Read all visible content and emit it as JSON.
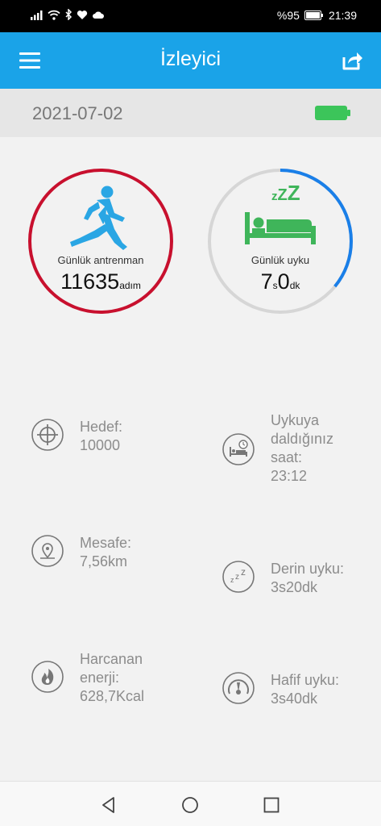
{
  "status_bar": {
    "battery_percent": "%95",
    "time": "21:39"
  },
  "app_bar": {
    "title": "İzleyici",
    "menu_icon": "hamburger-menu-icon",
    "share_icon": "share-icon"
  },
  "date_bar": {
    "date": "2021-07-02",
    "battery_icon": "device-battery-full-icon"
  },
  "activity": {
    "label": "Günlük antrenman",
    "steps": "11635",
    "unit": "adım",
    "ring_color": "#c8102e",
    "progress": 1.0
  },
  "sleep": {
    "label": "Günlük uyku",
    "hours": "7",
    "hours_unit": "s",
    "minutes": "0",
    "minutes_unit": "dk",
    "zzz": "zZZ",
    "ring_color": "#1a7fe8",
    "track_color": "#d6d6d6",
    "progress": 0.36
  },
  "stats_left": [
    {
      "icon": "target-icon",
      "lines": [
        "Hedef:",
        "10000"
      ]
    },
    {
      "icon": "location-pin-icon",
      "lines": [
        "Mesafe:",
        "7,56km"
      ]
    },
    {
      "icon": "flame-icon",
      "lines": [
        "Harcanan",
        "enerji:",
        "628,7Kcal"
      ]
    }
  ],
  "stats_right": [
    {
      "icon": "bed-clock-icon",
      "lines": [
        "Uykuya",
        "daldığınız",
        "saat:",
        "23:12"
      ]
    },
    {
      "icon": "zzz-icon",
      "lines": [
        "Derin uyku:",
        "3s20dk"
      ]
    },
    {
      "icon": "gauge-icon",
      "lines": [
        "Hafif uyku:",
        "3s40dk"
      ]
    }
  ],
  "colors": {
    "accent": "#1aa3e8",
    "battery_green": "#3cc55a",
    "sleep_green": "#3fb55a",
    "runner_blue": "#2aa6e4"
  }
}
